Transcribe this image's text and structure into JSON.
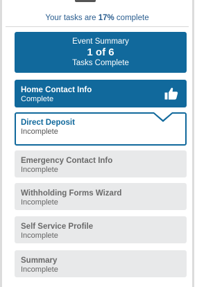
{
  "progress": {
    "prefix": "Your tasks are ",
    "percent": "17%",
    "suffix": " complete"
  },
  "summary": {
    "title": "Event Summary",
    "count": "1 of 6",
    "subtitle": "Tasks Complete"
  },
  "tasks": [
    {
      "name": "Home Contact Info",
      "status": "Complete"
    },
    {
      "name": "Direct Deposit",
      "status": "Incomplete"
    },
    {
      "name": "Emergency Contact Info",
      "status": "Incomplete"
    },
    {
      "name": "Withholding Forms Wizard",
      "status": "Incomplete"
    },
    {
      "name": "Self Service Profile",
      "status": "Incomplete"
    },
    {
      "name": "Summary",
      "status": "Incomplete"
    }
  ],
  "icons": {
    "complete_task": "thumbs-up-icon"
  },
  "colors": {
    "accent": "#11699c",
    "incomplete_bg": "#e8e9ea"
  }
}
